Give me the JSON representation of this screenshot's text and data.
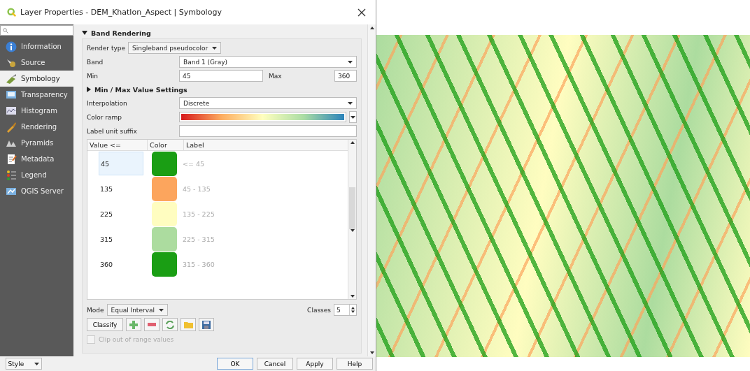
{
  "window": {
    "title": "Layer Properties - DEM_Khatlon_Aspect | Symbology"
  },
  "sidebar": {
    "items": [
      {
        "label": "Information",
        "selected": false
      },
      {
        "label": "Source",
        "selected": false
      },
      {
        "label": "Symbology",
        "selected": true
      },
      {
        "label": "Transparency",
        "selected": false
      },
      {
        "label": "Histogram",
        "selected": false
      },
      {
        "label": "Rendering",
        "selected": false
      },
      {
        "label": "Pyramids",
        "selected": false
      },
      {
        "label": "Metadata",
        "selected": false
      },
      {
        "label": "Legend",
        "selected": false
      },
      {
        "label": "QGIS Server",
        "selected": false
      }
    ]
  },
  "band_rendering": {
    "title": "Band Rendering",
    "expanded": true,
    "render_type": {
      "label": "Render type",
      "value": "Singleband pseudocolor"
    },
    "band": {
      "label": "Band",
      "value": "Band 1 (Gray)"
    },
    "min": {
      "label": "Min",
      "value": "45"
    },
    "max": {
      "label": "Max",
      "value": "360"
    },
    "min_max_settings": {
      "title": "Min / Max Value Settings",
      "expanded": false
    },
    "interpolation": {
      "label": "Interpolation",
      "value": "Discrete"
    },
    "color_ramp": {
      "label": "Color ramp"
    },
    "label_unit_suffix": {
      "label": "Label unit suffix"
    },
    "table": {
      "columns": [
        "Value <=",
        "Color",
        "Label"
      ],
      "rows": [
        {
          "value": "45",
          "color": "#1a9e14",
          "label": "<= 45",
          "selected": true
        },
        {
          "value": "135",
          "color": "#fca55d",
          "label": "45 - 135",
          "selected": false
        },
        {
          "value": "225",
          "color": "#fffdc0",
          "label": "135 - 225",
          "selected": false
        },
        {
          "value": "315",
          "color": "#acdc9f",
          "label": "225 - 315",
          "selected": false
        },
        {
          "value": "360",
          "color": "#1a9e14",
          "label": "315 - 360",
          "selected": false
        }
      ]
    },
    "mode": {
      "label": "Mode",
      "value": "Equal Interval"
    },
    "classes": {
      "label": "Classes",
      "value": "5"
    },
    "classify_button": "Classify",
    "clip": {
      "label": "Clip out of range values",
      "checked": false,
      "disabled": true
    }
  },
  "footer": {
    "style_button": "Style",
    "buttons": [
      {
        "label": "OK",
        "default": true
      },
      {
        "label": "Cancel",
        "default": false
      },
      {
        "label": "Apply",
        "default": false
      },
      {
        "label": "Help",
        "default": false
      }
    ]
  }
}
